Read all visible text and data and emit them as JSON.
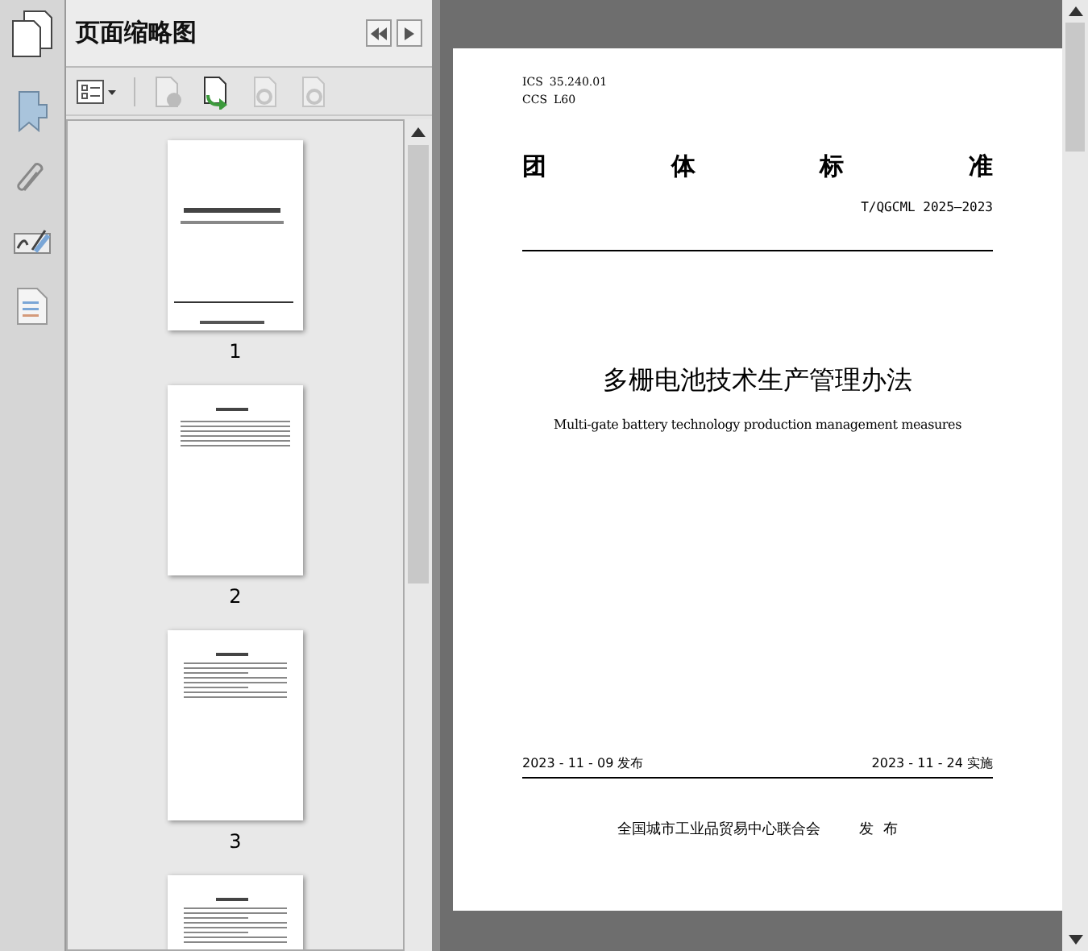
{
  "panel": {
    "title": "页面缩略图"
  },
  "thumbnails": [
    {
      "kind": "cover",
      "label": "1"
    },
    {
      "kind": "contents",
      "label": "2"
    },
    {
      "kind": "text",
      "label": "3"
    },
    {
      "kind": "text"
    }
  ],
  "document": {
    "meta": [
      {
        "key": "ICS",
        "value": "35.240.01"
      },
      {
        "key": "CCS",
        "value": "L60"
      }
    ],
    "heading": [
      "团",
      "体",
      "标",
      "准"
    ],
    "code": "T/QGCML 2025—2023",
    "title": "多栅电池技术生产管理办法",
    "subtitle": "Multi-gate battery technology production management measures",
    "issued": "2023 - 11 - 09 发布",
    "effective": "2023 - 11 - 24 实施",
    "publisher": "全国城市工业品贸易中心联合会",
    "publish_word": "发  布"
  }
}
